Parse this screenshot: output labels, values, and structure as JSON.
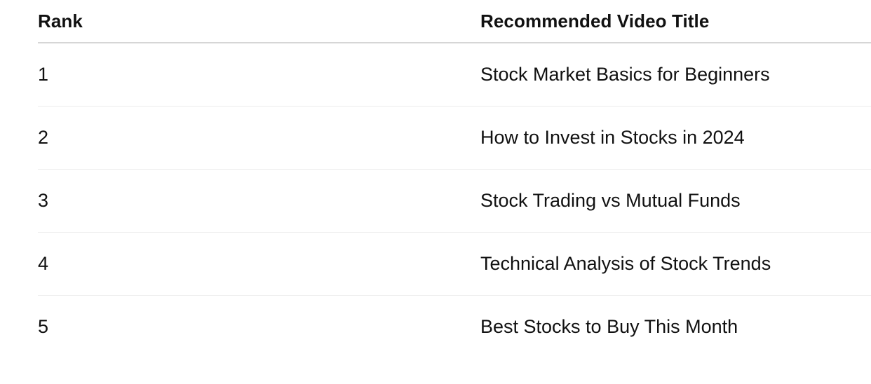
{
  "table": {
    "headers": {
      "rank": "Rank",
      "title": "Recommended Video Title"
    },
    "rows": [
      {
        "rank": "1",
        "title": "Stock Market Basics for Beginners"
      },
      {
        "rank": "2",
        "title": "How to Invest in Stocks in 2024"
      },
      {
        "rank": "3",
        "title": "Stock Trading vs Mutual Funds"
      },
      {
        "rank": "4",
        "title": "Technical Analysis of Stock Trends"
      },
      {
        "rank": "5",
        "title": "Best Stocks to Buy This Month"
      }
    ]
  }
}
